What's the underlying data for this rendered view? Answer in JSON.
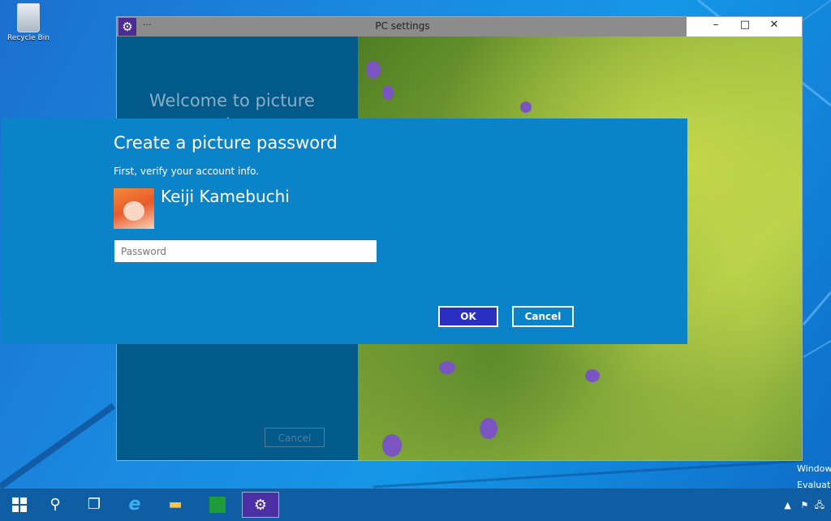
{
  "desktop": {
    "recycle_bin_label": "Recycle Bin",
    "watermark_line1": "Window",
    "watermark_line2": "Evaluati"
  },
  "window": {
    "title": "PC settings",
    "menu_dots": "···",
    "welcome_text": "Welcome to picture password",
    "background_cancel_label": "Cancel",
    "controls": {
      "minimize": "–",
      "maximize": "□",
      "close": "✕"
    }
  },
  "dialog": {
    "heading": "Create a picture password",
    "subtitle": "First, verify your account info.",
    "username": "Keiji Kamebuchi",
    "password_placeholder": "Password",
    "password_value": "",
    "ok_label": "OK",
    "cancel_label": "Cancel"
  },
  "taskbar": {
    "items": [
      {
        "icon": "windows-start-icon"
      },
      {
        "icon": "search-icon"
      },
      {
        "icon": "task-view-icon"
      },
      {
        "icon": "internet-explorer-icon"
      },
      {
        "icon": "file-explorer-icon"
      },
      {
        "icon": "store-icon"
      },
      {
        "icon": "settings-gear-icon",
        "active": true
      }
    ]
  }
}
